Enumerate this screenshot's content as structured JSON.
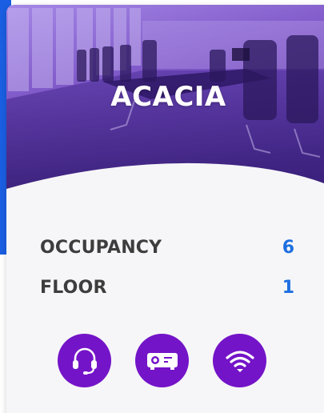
{
  "room": {
    "name": "ACACIA"
  },
  "details": [
    {
      "label": "OCCUPANCY",
      "value": "6"
    },
    {
      "label": "FLOOR",
      "value": "1"
    }
  ],
  "amenities": [
    {
      "icon": "headset-icon"
    },
    {
      "icon": "projector-icon"
    },
    {
      "icon": "wifi-icon"
    }
  ],
  "colors": {
    "accent_blue": "#1e6fe0",
    "amenity_purple": "#7414c8",
    "hero_overlay_top": "#8a5bd6",
    "hero_overlay_bottom": "#4a2b8f",
    "label_text": "#3d3d3d",
    "card_background": "#f6f6f8"
  }
}
